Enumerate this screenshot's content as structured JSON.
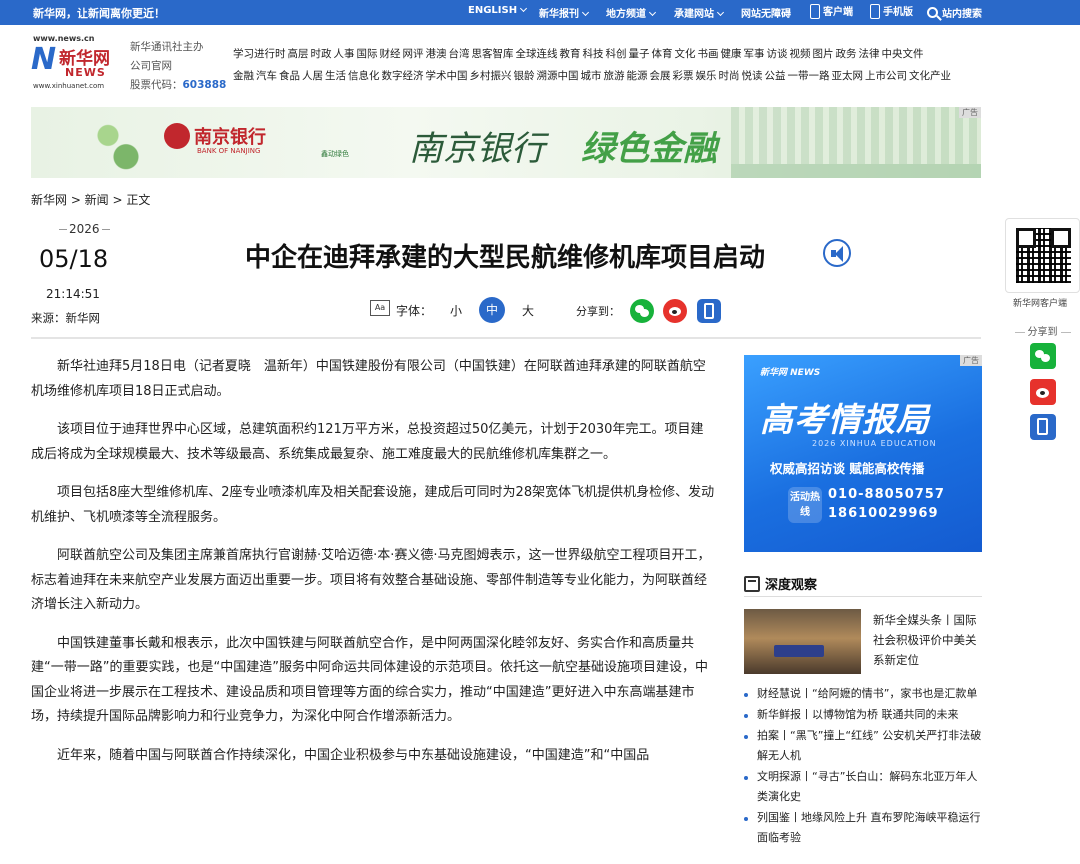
{
  "topbar": {
    "slogan": "新华网，让新闻离你更近！",
    "nav": [
      "ENGLISH",
      "新华报刊",
      "地方频道",
      "承建网站",
      "网站无障碍",
      "客户端",
      "手机版",
      "站内搜索"
    ]
  },
  "header": {
    "logo": {
      "url_top": "www.news.cn",
      "brand_cn": "新华网",
      "brand_en": "NEWS",
      "url_bottom": "www.xinhuanet.com"
    },
    "corp_line1": "新华通讯社主办",
    "corp_line2": "公司官网",
    "stock_label": "股票代码：",
    "stock_code": "603888",
    "nav_row1": [
      "学习进行时",
      "高层",
      "时政",
      "人事",
      "国际",
      "财经",
      "网评",
      "港澳",
      "台湾",
      "思客智库",
      "全球连线",
      "教育",
      "科技",
      "科创",
      "量子",
      "体育",
      "文化",
      "书画",
      "健康",
      "军事",
      "访谈",
      "视频",
      "图片",
      "政务",
      "法律",
      "中央文件"
    ],
    "nav_row2": [
      "金融",
      "汽车",
      "食品",
      "人居",
      "生活",
      "信息化",
      "数字经济",
      "学术中国",
      "乡村振兴",
      "银龄",
      "溯源中国",
      "城市",
      "旅游",
      "能源",
      "会展",
      "彩票",
      "娱乐",
      "时尚",
      "悦读",
      "公益",
      "一带一路",
      "亚太网",
      "上市公司",
      "文化产业"
    ]
  },
  "banner": {
    "ad_tag": "广告",
    "bank_name": "南京银行",
    "bank_en": "BANK OF NANJING",
    "sub_brand": "鑫动绿色",
    "slogan_a": "南京银行",
    "slogan_b": "绿色金融"
  },
  "breadcrumb": "新华网 > 新闻 > 正文",
  "article_meta": {
    "year": "2026",
    "month_day": "05/18",
    "time": "21:14:51",
    "source": "来源：新华网"
  },
  "title": "中企在迪拜承建的大型民航维修机库项目启动",
  "toolbar": {
    "font_label": "字体：",
    "font_icon": "Aa",
    "size_small": "小",
    "size_medium": "中",
    "size_large": "大",
    "share_label": "分享到："
  },
  "article": {
    "paragraphs": [
      "新华社迪拜5月18日电（记者夏晓　温新年）中国铁建股份有限公司（中国铁建）在阿联酋迪拜承建的阿联酋航空机场维修机库项目18日正式启动。",
      "该项目位于迪拜世界中心区域，总建筑面积约121万平方米，总投资超过50亿美元，计划于2030年完工。项目建成后将成为全球规模最大、技术等级最高、系统集成最复杂、施工难度最大的民航维修机库集群之一。",
      "项目包括8座大型维修机库、2座专业喷漆机库及相关配套设施，建成后可同时为28架宽体飞机提供机身检修、发动机维护、飞机喷漆等全流程服务。",
      "阿联酋航空公司及集团主席兼首席执行官谢赫·艾哈迈德·本·赛义德·马克图姆表示，这一世界级航空工程项目开工，标志着迪拜在未来航空产业发展方面迈出重要一步。项目将有效整合基础设施、零部件制造等专业化能力，为阿联酋经济增长注入新动力。",
      "中国铁建董事长戴和根表示，此次中国铁建与阿联酋航空合作，是中阿两国深化睦邻友好、务实合作和高质量共建“一带一路”的重要实践，也是“中国建造”服务中阿命运共同体建设的示范项目。依托这一航空基础设施项目建设，中国企业将进一步展示在工程技术、建设品质和项目管理等方面的综合实力，推动“中国建造”更好进入中东高端基建市场，持续提升国际品牌影响力和行业竞争力，为深化中阿合作增添新活力。",
      "近年来，随着中国与阿联酋合作持续深化，中国企业积极参与中东基础设施建设，“中国建造”和“中国品"
    ]
  },
  "side_ad": {
    "ad_tag": "广告",
    "logo": "新华网 NEWS",
    "headline": "高考情报局",
    "en": "2026 XINHUA EDUCATION",
    "subtitle": "权威高招访谈  赋能高校传播",
    "hotline_label": "活动热线",
    "phone1": "010-88050757",
    "phone2": "18610029969"
  },
  "deep": {
    "title": "深度观察",
    "headline": "新华全媒头条丨国际社会积极评价中美关系新定位",
    "items": [
      "财经慧说丨“给阿嬷的情书”，家书也是汇款单",
      "新华鲜报丨以博物馆为桥 联通共同的未来",
      "拍案丨“黑飞”撞上“红线” 公安机关严打非法破解无人机",
      "文明探源丨“寻古”长白山：解码东北亚万年人类演化史",
      "列国鉴丨地缘风险上升 直布罗陀海峡平稳运行面临考验"
    ]
  },
  "sidebar": {
    "qr_label": "新华网客户端",
    "share_label": "分享到"
  },
  "colors": {
    "brand_blue": "#2a69c9",
    "brand_red": "#c1272d",
    "wechat_green": "#17b23b",
    "weibo_red": "#e6322c"
  }
}
